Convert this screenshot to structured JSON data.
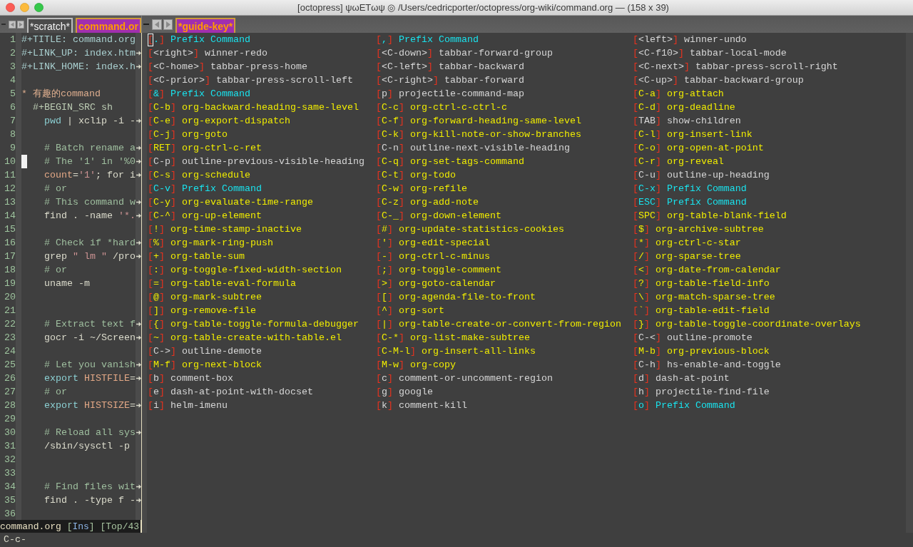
{
  "window": {
    "title": "[octopress] ψωETωψ ◎ /Users/cedricporter/octopress/org-wiki/command.org — (158 x 39)"
  },
  "left_window": {
    "tabs": [
      {
        "label": "*scratch*",
        "selected": false
      },
      {
        "label": "command.or",
        "selected": true
      }
    ],
    "lines": [
      {
        "number": "1",
        "segments": [
          {
            "kind": "keyword",
            "text": "#+TITLE: command.org"
          }
        ],
        "truncated": false,
        "cursor": false
      },
      {
        "number": "2",
        "segments": [
          {
            "kind": "keyword",
            "text": "#+LINK_UP: index.htm"
          }
        ],
        "truncated": true,
        "cursor": false
      },
      {
        "number": "3",
        "segments": [
          {
            "kind": "keyword",
            "text": "#+LINK_HOME: index.h"
          }
        ],
        "truncated": true,
        "cursor": false
      },
      {
        "number": "4",
        "truncated": false,
        "cursor": false
      },
      {
        "number": "5",
        "segments": [
          {
            "kind": "heading",
            "text": "* 有趣的command"
          }
        ],
        "truncated": false,
        "cursor": false
      },
      {
        "number": "6",
        "segments": [
          {
            "kind": "meta",
            "text": "  #+BEGIN_SRC sh"
          }
        ],
        "truncated": false,
        "cursor": false
      },
      {
        "number": "7",
        "segments": [
          {
            "kind": "builtin",
            "text": "    pwd"
          },
          {
            "kind": "plain",
            "text": " | xclip -i -"
          }
        ],
        "truncated": true,
        "cursor": false
      },
      {
        "number": "8",
        "truncated": false,
        "cursor": false
      },
      {
        "number": "9",
        "segments": [
          {
            "kind": "comment",
            "text": "    # Batch rename a"
          }
        ],
        "truncated": true,
        "cursor": false
      },
      {
        "number": "10",
        "segments": [
          {
            "kind": "comment",
            "text": "    # The '1' in '%0"
          }
        ],
        "truncated": true,
        "cursor": true
      },
      {
        "number": "11",
        "segments": [
          {
            "kind": "variable",
            "text": "    count"
          },
          {
            "kind": "plain",
            "text": "="
          },
          {
            "kind": "string",
            "text": "'1'"
          },
          {
            "kind": "plain",
            "text": "; for i"
          }
        ],
        "truncated": true,
        "cursor": false
      },
      {
        "number": "12",
        "segments": [
          {
            "kind": "comment",
            "text": "    # or"
          }
        ],
        "truncated": false,
        "cursor": false
      },
      {
        "number": "13",
        "segments": [
          {
            "kind": "comment",
            "text": "    # This command w"
          }
        ],
        "truncated": true,
        "cursor": false
      },
      {
        "number": "14",
        "segments": [
          {
            "kind": "plain",
            "text": "    find . -name "
          },
          {
            "kind": "string",
            "text": "'*."
          }
        ],
        "truncated": true,
        "cursor": false
      },
      {
        "number": "15",
        "truncated": false,
        "cursor": false
      },
      {
        "number": "16",
        "segments": [
          {
            "kind": "comment",
            "text": "    # Check if *hard"
          }
        ],
        "truncated": true,
        "cursor": false
      },
      {
        "number": "17",
        "segments": [
          {
            "kind": "plain",
            "text": "    grep "
          },
          {
            "kind": "string",
            "text": "\" lm \""
          },
          {
            "kind": "plain",
            "text": " /pro"
          }
        ],
        "truncated": true,
        "cursor": false
      },
      {
        "number": "18",
        "segments": [
          {
            "kind": "comment",
            "text": "    # or"
          }
        ],
        "truncated": false,
        "cursor": false
      },
      {
        "number": "19",
        "segments": [
          {
            "kind": "plain",
            "text": "    uname -m"
          }
        ],
        "truncated": false,
        "cursor": false
      },
      {
        "number": "20",
        "truncated": false,
        "cursor": false
      },
      {
        "number": "21",
        "truncated": false,
        "cursor": false
      },
      {
        "number": "22",
        "segments": [
          {
            "kind": "comment",
            "text": "    # Extract text f"
          }
        ],
        "truncated": true,
        "cursor": false
      },
      {
        "number": "23",
        "segments": [
          {
            "kind": "plain",
            "text": "    gocr -i ~/Screen"
          }
        ],
        "truncated": true,
        "cursor": false
      },
      {
        "number": "24",
        "truncated": false,
        "cursor": false
      },
      {
        "number": "25",
        "segments": [
          {
            "kind": "comment",
            "text": "    # Let you vanish"
          }
        ],
        "truncated": true,
        "cursor": false
      },
      {
        "number": "26",
        "segments": [
          {
            "kind": "builtin",
            "text": "    export "
          },
          {
            "kind": "variable",
            "text": "HISTFILE"
          },
          {
            "kind": "plain",
            "text": "="
          }
        ],
        "truncated": true,
        "cursor": false
      },
      {
        "number": "27",
        "segments": [
          {
            "kind": "comment",
            "text": "    # or"
          }
        ],
        "truncated": false,
        "cursor": false
      },
      {
        "number": "28",
        "segments": [
          {
            "kind": "builtin",
            "text": "    export "
          },
          {
            "kind": "variable",
            "text": "HISTSIZE"
          },
          {
            "kind": "plain",
            "text": "="
          }
        ],
        "truncated": true,
        "cursor": false
      },
      {
        "number": "29",
        "truncated": false,
        "cursor": false
      },
      {
        "number": "30",
        "segments": [
          {
            "kind": "comment",
            "text": "    # Reload all sys"
          }
        ],
        "truncated": true,
        "cursor": false
      },
      {
        "number": "31",
        "segments": [
          {
            "kind": "plain",
            "text": "    /sbin/sysctl -p"
          }
        ],
        "truncated": false,
        "cursor": false
      },
      {
        "number": "32",
        "truncated": false,
        "cursor": false
      },
      {
        "number": "33",
        "truncated": false,
        "cursor": false
      },
      {
        "number": "34",
        "segments": [
          {
            "kind": "comment",
            "text": "    # Find files wit"
          }
        ],
        "truncated": true,
        "cursor": false
      },
      {
        "number": "35",
        "segments": [
          {
            "kind": "plain",
            "text": "    find . -type f -"
          }
        ],
        "truncated": true,
        "cursor": false
      },
      {
        "number": "36",
        "truncated": false,
        "cursor": false
      }
    ],
    "mode_line": [
      {
        "kind": "buffer",
        "text": "command.org"
      },
      {
        "kind": "info",
        "text": " ["
      },
      {
        "kind": "accent",
        "text": "Ins"
      },
      {
        "kind": "info",
        "text": "] [Top/43"
      }
    ]
  },
  "right_window": {
    "tabs": [
      {
        "label": "*guide-key*",
        "selected": true
      }
    ],
    "cursor": true,
    "columns": [
      [
        {
          "key": "[.]",
          "command": "Prefix Command",
          "kind": "prefix"
        },
        {
          "key": "[<right>]",
          "command": "winner-redo",
          "kind": "plain"
        },
        {
          "key": "[<C-home>]",
          "command": "tabbar-press-home",
          "kind": "plain"
        },
        {
          "key": "[<C-prior>]",
          "command": "tabbar-press-scroll-left",
          "kind": "plain"
        },
        {
          "key": "[&]",
          "command": "Prefix Command",
          "kind": "prefix"
        },
        {
          "key": "[C-b]",
          "command": "org-backward-heading-same-level",
          "kind": "org"
        },
        {
          "key": "[C-e]",
          "command": "org-export-dispatch",
          "kind": "org"
        },
        {
          "key": "[C-j]",
          "command": "org-goto",
          "kind": "org"
        },
        {
          "key": "[RET]",
          "command": "org-ctrl-c-ret",
          "kind": "org"
        },
        {
          "key": "[C-p]",
          "command": "outline-previous-visible-heading",
          "kind": "plain"
        },
        {
          "key": "[C-s]",
          "command": "org-schedule",
          "kind": "org"
        },
        {
          "key": "[C-v]",
          "command": "Prefix Command",
          "kind": "prefix"
        },
        {
          "key": "[C-y]",
          "command": "org-evaluate-time-range",
          "kind": "org"
        },
        {
          "key": "[C-^]",
          "command": "org-up-element",
          "kind": "org"
        },
        {
          "key": "[!]",
          "command": "org-time-stamp-inactive",
          "kind": "org"
        },
        {
          "key": "[%]",
          "command": "org-mark-ring-push",
          "kind": "org"
        },
        {
          "key": "[+]",
          "command": "org-table-sum",
          "kind": "org"
        },
        {
          "key": "[:]",
          "command": "org-toggle-fixed-width-section",
          "kind": "org"
        },
        {
          "key": "[=]",
          "command": "org-table-eval-formula",
          "kind": "org"
        },
        {
          "key": "[@]",
          "command": "org-mark-subtree",
          "kind": "org"
        },
        {
          "key": "[]]",
          "command": "org-remove-file",
          "kind": "org"
        },
        {
          "key": "[{]",
          "command": "org-table-toggle-formula-debugger",
          "kind": "org"
        },
        {
          "key": "[~]",
          "command": "org-table-create-with-table.el",
          "kind": "org"
        },
        {
          "key": "[C->]",
          "command": "outline-demote",
          "kind": "plain"
        },
        {
          "key": "[M-f]",
          "command": "org-next-block",
          "kind": "org"
        },
        {
          "key": "[b]",
          "command": "comment-box",
          "kind": "plain"
        },
        {
          "key": "[e]",
          "command": "dash-at-point-with-docset",
          "kind": "plain"
        },
        {
          "key": "[i]",
          "command": "helm-imenu",
          "kind": "plain"
        }
      ],
      [
        {
          "key": "[,]",
          "command": "Prefix Command",
          "kind": "prefix"
        },
        {
          "key": "[<C-down>]",
          "command": "tabbar-forward-group",
          "kind": "plain"
        },
        {
          "key": "[<C-left>]",
          "command": "tabbar-backward",
          "kind": "plain"
        },
        {
          "key": "[<C-right>]",
          "command": "tabbar-forward",
          "kind": "plain"
        },
        {
          "key": "[p]",
          "command": "projectile-command-map",
          "kind": "plain"
        },
        {
          "key": "[C-c]",
          "command": "org-ctrl-c-ctrl-c",
          "kind": "org"
        },
        {
          "key": "[C-f]",
          "command": "org-forward-heading-same-level",
          "kind": "org"
        },
        {
          "key": "[C-k]",
          "command": "org-kill-note-or-show-branches",
          "kind": "org"
        },
        {
          "key": "[C-n]",
          "command": "outline-next-visible-heading",
          "kind": "plain"
        },
        {
          "key": "[C-q]",
          "command": "org-set-tags-command",
          "kind": "org"
        },
        {
          "key": "[C-t]",
          "command": "org-todo",
          "kind": "org"
        },
        {
          "key": "[C-w]",
          "command": "org-refile",
          "kind": "org"
        },
        {
          "key": "[C-z]",
          "command": "org-add-note",
          "kind": "org"
        },
        {
          "key": "[C-_]",
          "command": "org-down-element",
          "kind": "org"
        },
        {
          "key": "[#]",
          "command": "org-update-statistics-cookies",
          "kind": "org"
        },
        {
          "key": "[']",
          "command": "org-edit-special",
          "kind": "org"
        },
        {
          "key": "[-]",
          "command": "org-ctrl-c-minus",
          "kind": "org"
        },
        {
          "key": "[;]",
          "command": "org-toggle-comment",
          "kind": "org"
        },
        {
          "key": "[>]",
          "command": "org-goto-calendar",
          "kind": "org"
        },
        {
          "key": "[[]",
          "command": "org-agenda-file-to-front",
          "kind": "org"
        },
        {
          "key": "[^]",
          "command": "org-sort",
          "kind": "org"
        },
        {
          "key": "[|]",
          "command": "org-table-create-or-convert-from-region",
          "kind": "org"
        },
        {
          "key": "[C-*]",
          "command": "org-list-make-subtree",
          "kind": "org"
        },
        {
          "key": "[C-M-l]",
          "command": "org-insert-all-links",
          "kind": "org"
        },
        {
          "key": "[M-w]",
          "command": "org-copy",
          "kind": "org"
        },
        {
          "key": "[c]",
          "command": "comment-or-uncomment-region",
          "kind": "plain"
        },
        {
          "key": "[g]",
          "command": "google",
          "kind": "plain"
        },
        {
          "key": "[k]",
          "command": "comment-kill",
          "kind": "plain"
        }
      ],
      [
        {
          "key": "[<left>]",
          "command": "winner-undo",
          "kind": "plain"
        },
        {
          "key": "[<C-f10>]",
          "command": "tabbar-local-mode",
          "kind": "plain"
        },
        {
          "key": "[<C-next>]",
          "command": "tabbar-press-scroll-right",
          "kind": "plain"
        },
        {
          "key": "[<C-up>]",
          "command": "tabbar-backward-group",
          "kind": "plain"
        },
        {
          "key": "[C-a]",
          "command": "org-attach",
          "kind": "org"
        },
        {
          "key": "[C-d]",
          "command": "org-deadline",
          "kind": "org"
        },
        {
          "key": "[TAB]",
          "command": "show-children",
          "kind": "plain"
        },
        {
          "key": "[C-l]",
          "command": "org-insert-link",
          "kind": "org"
        },
        {
          "key": "[C-o]",
          "command": "org-open-at-point",
          "kind": "org"
        },
        {
          "key": "[C-r]",
          "command": "org-reveal",
          "kind": "org"
        },
        {
          "key": "[C-u]",
          "command": "outline-up-heading",
          "kind": "plain"
        },
        {
          "key": "[C-x]",
          "command": "Prefix Command",
          "kind": "prefix"
        },
        {
          "key": "[ESC]",
          "command": "Prefix Command",
          "kind": "prefix"
        },
        {
          "key": "[SPC]",
          "command": "org-table-blank-field",
          "kind": "org"
        },
        {
          "key": "[$]",
          "command": "org-archive-subtree",
          "kind": "org"
        },
        {
          "key": "[*]",
          "command": "org-ctrl-c-star",
          "kind": "org"
        },
        {
          "key": "[/]",
          "command": "org-sparse-tree",
          "kind": "org"
        },
        {
          "key": "[<]",
          "command": "org-date-from-calendar",
          "kind": "org"
        },
        {
          "key": "[?]",
          "command": "org-table-field-info",
          "kind": "org"
        },
        {
          "key": "[\\]",
          "command": "org-match-sparse-tree",
          "kind": "org"
        },
        {
          "key": "[`]",
          "command": "org-table-edit-field",
          "kind": "org"
        },
        {
          "key": "[}]",
          "command": "org-table-toggle-coordinate-overlays",
          "kind": "org"
        },
        {
          "key": "[C-<]",
          "command": "outline-promote",
          "kind": "plain"
        },
        {
          "key": "[M-b]",
          "command": "org-previous-block",
          "kind": "org"
        },
        {
          "key": "[C-h]",
          "command": "hs-enable-and-toggle",
          "kind": "plain"
        },
        {
          "key": "[d]",
          "command": "dash-at-point",
          "kind": "plain"
        },
        {
          "key": "[h]",
          "command": "projectile-find-file",
          "kind": "plain"
        },
        {
          "key": "[o]",
          "command": "Prefix Command",
          "kind": "prefix"
        }
      ]
    ]
  },
  "minibuffer": {
    "text": "C-c-"
  }
}
